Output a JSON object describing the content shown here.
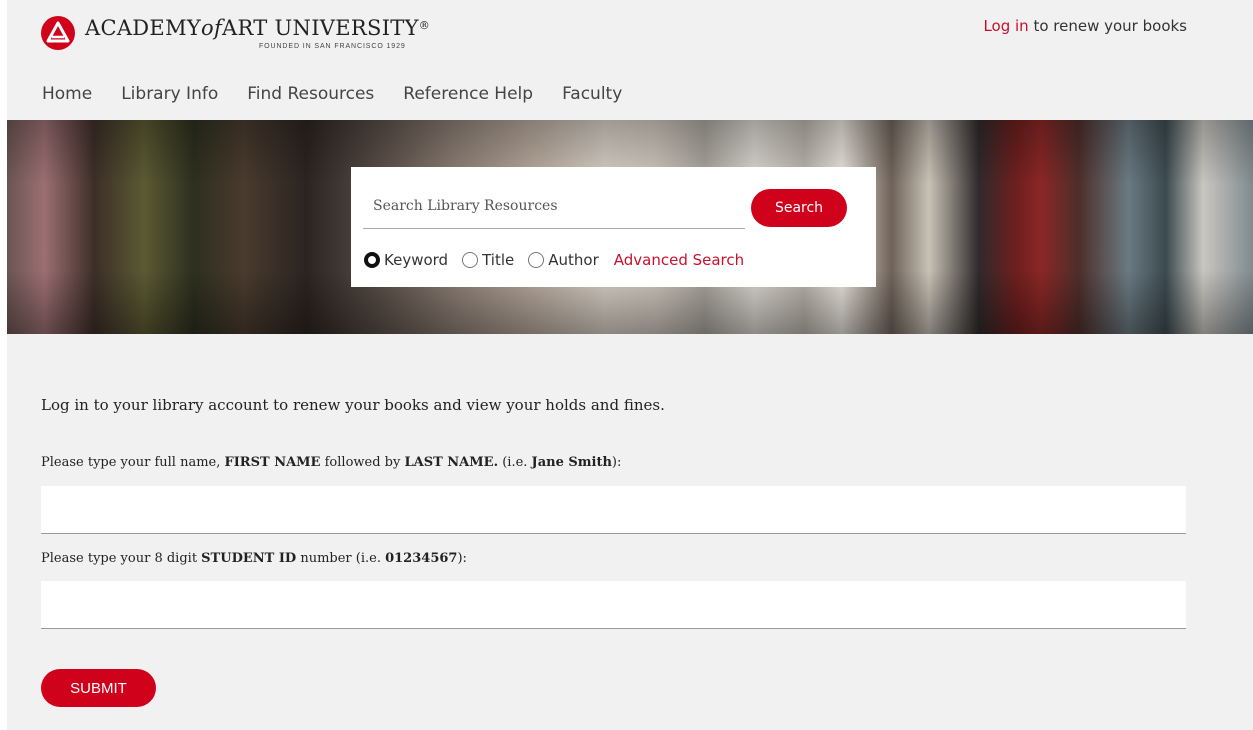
{
  "header": {
    "logo_name_1": "ACADEMY",
    "logo_name_of": "of",
    "logo_name_2": "ART UNIVERSITY",
    "logo_reg": "®",
    "logo_sub": "FOUNDED IN SAN FRANCISCO 1929",
    "login_link": "Log in",
    "login_rest": " to renew your books"
  },
  "nav": {
    "items": [
      {
        "label": "Home"
      },
      {
        "label": "Library Info"
      },
      {
        "label": "Find Resources"
      },
      {
        "label": "Reference Help"
      },
      {
        "label": "Faculty"
      }
    ]
  },
  "search": {
    "placeholder": "Search Library Resources",
    "value": "",
    "button_label": "Search",
    "options": [
      {
        "label": "Keyword",
        "checked": true
      },
      {
        "label": "Title",
        "checked": false
      },
      {
        "label": "Author",
        "checked": false
      }
    ],
    "advanced_label": "Advanced Search"
  },
  "form": {
    "intro": "Log in to your library account to renew your books and view your holds and fines.",
    "name_label_1": "Please type your full name, ",
    "name_label_b1": "FIRST NAME",
    "name_label_2": " followed by ",
    "name_label_b2": "LAST NAME.",
    "name_label_3": " (i.e. ",
    "name_label_b3": "Jane Smith",
    "name_label_4": "):",
    "name_value": "",
    "id_label_1": "Please type your 8 digit ",
    "id_label_b1": "STUDENT ID",
    "id_label_2": " number (i.e. ",
    "id_label_b2": "01234567",
    "id_label_3": "):",
    "id_value": "",
    "submit_label": "SUBMIT"
  },
  "colors": {
    "accent": "#d0021b",
    "link": "#c8102e",
    "background": "#f1f1f1"
  }
}
